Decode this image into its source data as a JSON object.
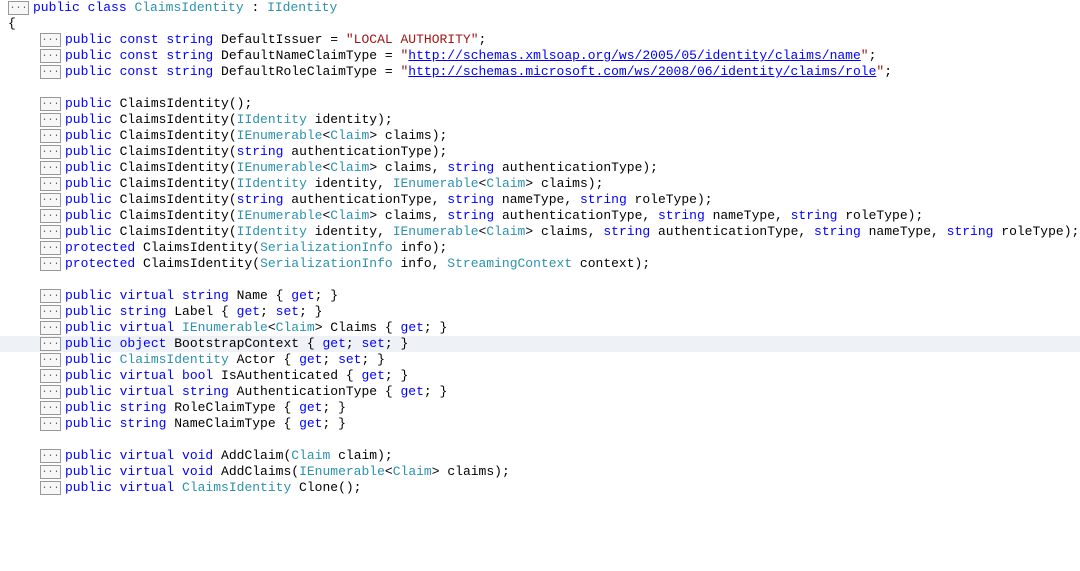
{
  "decl": {
    "kw": "public class",
    "name": "ClaimsIdentity",
    "base": "IIdentity"
  },
  "open_brace": "{",
  "const1": {
    "kw": "public const string",
    "ident": "DefaultIssuer",
    "eq": " = ",
    "val": "\"LOCAL AUTHORITY\"",
    "semi": ";"
  },
  "const2": {
    "kw": "public const string",
    "ident": "DefaultNameClaimType",
    "eq": " = ",
    "q": "\"",
    "url": "http://schemas.xmlsoap.org/ws/2005/05/identity/claims/name",
    "semi": ";"
  },
  "const3": {
    "kw": "public const string",
    "ident": "DefaultRoleClaimType",
    "eq": " = ",
    "q": "\"",
    "url": "http://schemas.microsoft.com/ws/2008/06/identity/claims/role",
    "semi": ";"
  },
  "ctor0": {
    "kw": "public",
    "name": "ClaimsIdentity",
    "params": "();"
  },
  "ctor1": {
    "kw": "public",
    "name": "ClaimsIdentity",
    "open": "(",
    "p1t": "IIdentity",
    "p1n": " identity",
    "close": ");"
  },
  "ctor2": {
    "kw": "public",
    "name": "ClaimsIdentity",
    "open": "(",
    "p1t": "IEnumerable",
    "lt": "<",
    "p1g": "Claim",
    "gt": "> claims",
    "close": ");"
  },
  "ctor3": {
    "kw": "public",
    "name": "ClaimsIdentity",
    "open": "(",
    "p1t": "string",
    "p1n": " authenticationType",
    "close": ");"
  },
  "ctor4": {
    "kw": "public",
    "name": "ClaimsIdentity",
    "open": "(",
    "p1t": "IEnumerable",
    "lt": "<",
    "p1g": "Claim",
    "gt": "> claims, ",
    "p2t": "string",
    "p2n": " authenticationType",
    "close": ");"
  },
  "ctor5": {
    "kw": "public",
    "name": "ClaimsIdentity",
    "open": "(",
    "p1t": "IIdentity",
    "p1n": " identity, ",
    "p2t": "IEnumerable",
    "lt": "<",
    "p2g": "Claim",
    "gt": "> claims",
    "close": ");"
  },
  "ctor6": {
    "kw": "public",
    "name": "ClaimsIdentity",
    "open": "(",
    "p1t": "string",
    "p1n": " authenticationType, ",
    "p2t": "string",
    "p2n": " nameType, ",
    "p3t": "string",
    "p3n": " roleType",
    "close": ");"
  },
  "ctor7": {
    "kw": "public",
    "name": "ClaimsIdentity",
    "open": "(",
    "p1t": "IEnumerable",
    "lt": "<",
    "p1g": "Claim",
    "gt": "> claims, ",
    "p2t": "string",
    "p2n": " authenticationType, ",
    "p3t": "string",
    "p3n": " nameType, ",
    "p4t": "string",
    "p4n": " roleType",
    "close": ");"
  },
  "ctor8": {
    "kw": "public",
    "name": "ClaimsIdentity",
    "open": "(",
    "p1t": "IIdentity",
    "p1n": " identity, ",
    "p2t": "IEnumerable",
    "lt": "<",
    "p2g": "Claim",
    "gt": "> claims, ",
    "p3t": "string",
    "p3n": " authenticationType, ",
    "p4t": "string",
    "p4n": " nameType, ",
    "p5t": "string",
    "p5n": " roleType",
    "close": ");"
  },
  "ctor9": {
    "kw": "protected",
    "name": "ClaimsIdentity",
    "open": "(",
    "p1t": "SerializationInfo",
    "p1n": " info",
    "close": ");"
  },
  "ctor10": {
    "kw": "protected",
    "name": "ClaimsIdentity",
    "open": "(",
    "p1t": "SerializationInfo",
    "p1n": " info, ",
    "p2t": "StreamingContext",
    "p2n": " context",
    "close": ");"
  },
  "prop0": {
    "kw": "public virtual string",
    "name": "Name",
    "acc": " { ",
    "get": "get",
    "end": "; }"
  },
  "prop1": {
    "kw": "public string",
    "name": "Label",
    "acc": " { ",
    "get": "get",
    "sep": "; ",
    "set": "set",
    "end": "; }"
  },
  "prop2": {
    "kw": "public virtual",
    "t1": "IEnumerable",
    "lt": "<",
    "t1g": "Claim",
    "gt": "> Claims",
    "acc": " { ",
    "get": "get",
    "end": "; }"
  },
  "prop3": {
    "kw": "public object",
    "name": "BootstrapContext",
    "acc": " { ",
    "get": "get",
    "sep": "; ",
    "set": "set",
    "end": "; }"
  },
  "prop4": {
    "kw": "public",
    "t1": "ClaimsIdentity",
    "name": " Actor",
    "acc": " { ",
    "get": "get",
    "sep": "; ",
    "set": "set",
    "end": "; }"
  },
  "prop5": {
    "kw": "public virtual bool",
    "name": "IsAuthenticated",
    "acc": " { ",
    "get": "get",
    "end": "; }"
  },
  "prop6": {
    "kw": "public virtual string",
    "name": "AuthenticationType",
    "acc": " { ",
    "get": "get",
    "end": "; }"
  },
  "prop7": {
    "kw": "public string",
    "name": "RoleClaimType",
    "acc": " { ",
    "get": "get",
    "end": "; }"
  },
  "prop8": {
    "kw": "public string",
    "name": "NameClaimType",
    "acc": " { ",
    "get": "get",
    "end": "; }"
  },
  "m0": {
    "kw": "public virtual void",
    "name": "AddClaim",
    "open": "(",
    "p1t": "Claim",
    "p1n": " claim",
    "close": ");"
  },
  "m1": {
    "kw": "public virtual void",
    "name": "AddClaims",
    "open": "(",
    "p1t": "IEnumerable",
    "lt": "<",
    "p1g": "Claim",
    "gt": "> claims",
    "close": ");"
  },
  "m2": {
    "kw": "public virtual",
    "t1": "ClaimsIdentity",
    "name": " Clone",
    "close": "();"
  }
}
